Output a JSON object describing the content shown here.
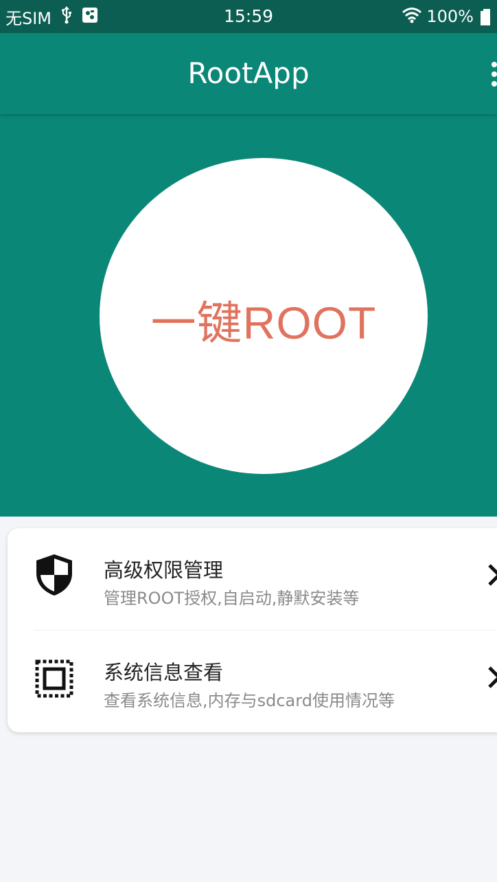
{
  "status_bar": {
    "carrier": "无SIM",
    "time": "15:59",
    "battery": "100%",
    "icons": [
      "usb-icon",
      "usb-debug-icon",
      "wifi-icon",
      "battery-icon"
    ]
  },
  "app_bar": {
    "title": "RootApp",
    "menu_icon": "overflow-menu-icon"
  },
  "hero": {
    "button_label": "一键ROOT"
  },
  "menu_items": [
    {
      "title": "高级权限管理",
      "subtitle": "管理ROOT授权,自启动,静默安装等",
      "icon": "shield-icon"
    },
    {
      "title": "系统信息查看",
      "subtitle": "查看系统信息,内存与sdcard使用情况等",
      "icon": "chip-icon"
    }
  ],
  "colors": {
    "status_bar": "#0c5e52",
    "primary": "#0b8777",
    "root_label": "#e0735e",
    "background": "#f3f5f8"
  }
}
